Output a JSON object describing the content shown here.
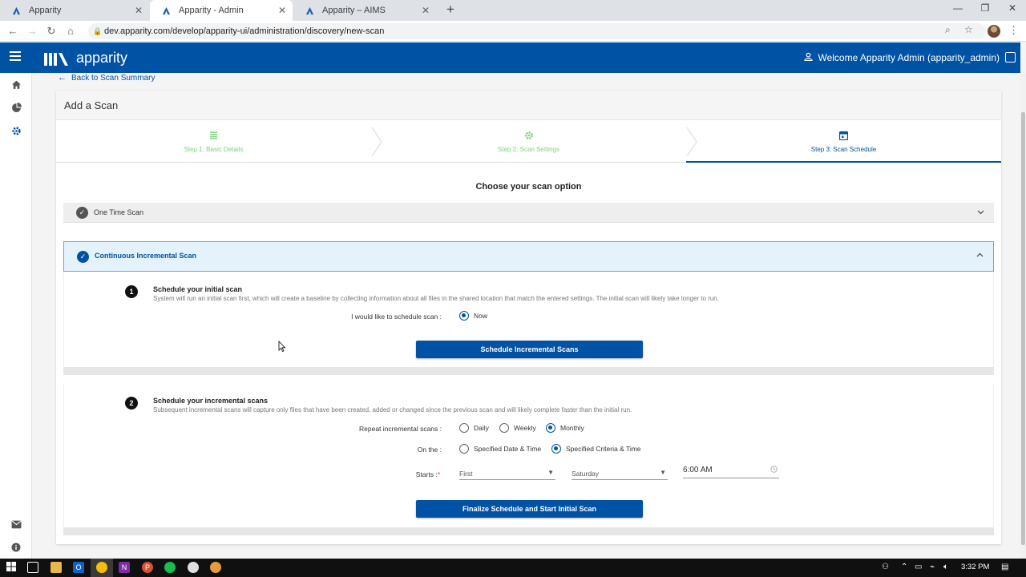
{
  "browser": {
    "tabs": [
      {
        "title": "Apparity",
        "active": false
      },
      {
        "title": "Apparity - Admin",
        "active": true
      },
      {
        "title": "Apparity – AIMS",
        "active": false
      }
    ],
    "url": "dev.apparity.com/develop/apparity-ui/administration/discovery/new-scan",
    "new_tab_icon": "plus-icon"
  },
  "header": {
    "logo_text": "apparity",
    "welcome": "Welcome Apparity Admin (apparity_admin)",
    "brand_color": "#0052a5"
  },
  "sidebar": {
    "icons": [
      "home-icon",
      "pie-chart-icon",
      "gear-icon",
      "mail-icon",
      "info-icon"
    ]
  },
  "page": {
    "back_link": "Back to Scan Summary",
    "title": "Add a Scan",
    "steps": [
      {
        "label": "Step 1: Basic Details",
        "status": "done",
        "icon": "list-icon"
      },
      {
        "label": "Step 2: Scan Settings",
        "status": "done",
        "icon": "gear-icon"
      },
      {
        "label": "Step 3: Scan Schedule",
        "status": "current",
        "icon": "calendar-icon"
      }
    ],
    "choose_heading": "Choose your scan option",
    "options": [
      {
        "label": "One Time Scan",
        "expanded": false
      },
      {
        "label": "Continuous Incremental Scan",
        "expanded": true
      }
    ],
    "section1": {
      "number": "1",
      "title": "Schedule your initial scan",
      "description": "System will run an initial scan first, which will create a baseline by collecting information about all files in the shared location that match the entered settings. The initial scan will likely take longer to run.",
      "schedule_label": "I would like to schedule scan :",
      "schedule_option": "Now",
      "button": "Schedule Incremental Scans"
    },
    "section2": {
      "number": "2",
      "title": "Schedule your incremental scans",
      "description": "Subsequent incremental scans will capture only files that have been created, added or changed since the previous scan and will likely complete faster than the initial run.",
      "repeat_label": "Repeat incremental scans :",
      "repeat_options": [
        "Daily",
        "Weekly",
        "Monthly"
      ],
      "repeat_selected": "Monthly",
      "on_the_label": "On the :",
      "on_the_options": [
        "Specified Date & Time",
        "Specified Criteria & Time"
      ],
      "on_the_selected": "Specified Criteria & Time",
      "starts_label": "Starts :",
      "starts_required": "*",
      "starts_week": "First",
      "starts_day": "Saturday",
      "starts_time": "6:00 AM",
      "button": "Finalize Schedule and Start Initial Scan"
    }
  },
  "taskbar": {
    "clock": "3:32 PM"
  }
}
